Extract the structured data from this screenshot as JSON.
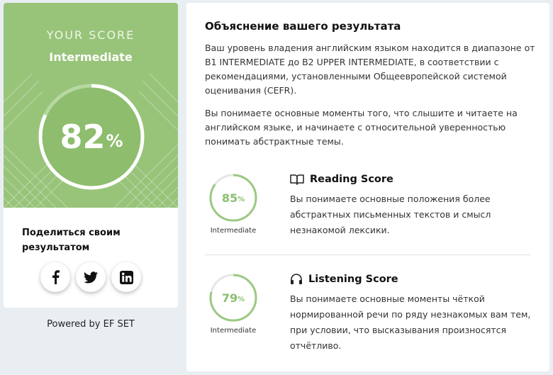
{
  "score_card": {
    "heading": "YOUR SCORE",
    "level": "Intermediate",
    "score_number": "82",
    "score_value": 82,
    "percent_sign": "%",
    "share_title": "Поделиться своим результатом",
    "social": [
      {
        "name": "facebook",
        "icon": "facebook-icon"
      },
      {
        "name": "twitter",
        "icon": "twitter-icon"
      },
      {
        "name": "linkedin",
        "icon": "linkedin-icon"
      }
    ],
    "accent_color": "#98c47a"
  },
  "powered_by": "Powered by EF SET",
  "explanation": {
    "title": "Объяснение вашего результата",
    "paragraph1": "Ваш уровень владения английским языком находится в диапазоне от B1 INTERMEDIATE до B2 UPPER INTERMEDIATE, в соответствии с рекомендациями, установленными Общеевропейской системой оценивания (CEFR).",
    "paragraph2": "Вы понимаете основные моменты того, что слышите и читаете на английском языке, и начинаете с относительной уверенностью понимать абстрактные темы."
  },
  "reading": {
    "title": "Reading Score",
    "icon": "book-icon",
    "score_number": "85",
    "score_value": 85,
    "percent_sign": "%",
    "level": "Intermediate",
    "description": "Вы понимаете основные положения более абстрактных письменных текстов и смысл незнакомой лексики."
  },
  "listening": {
    "title": "Listening Score",
    "icon": "headphones-icon",
    "score_number": "79",
    "score_value": 79,
    "percent_sign": "%",
    "level": "Intermediate",
    "description": "Вы понимаете основные моменты чёткой нормированной речи по ряду незнакомых вам тем, при условии, что высказывания произносятся отчётливо."
  }
}
